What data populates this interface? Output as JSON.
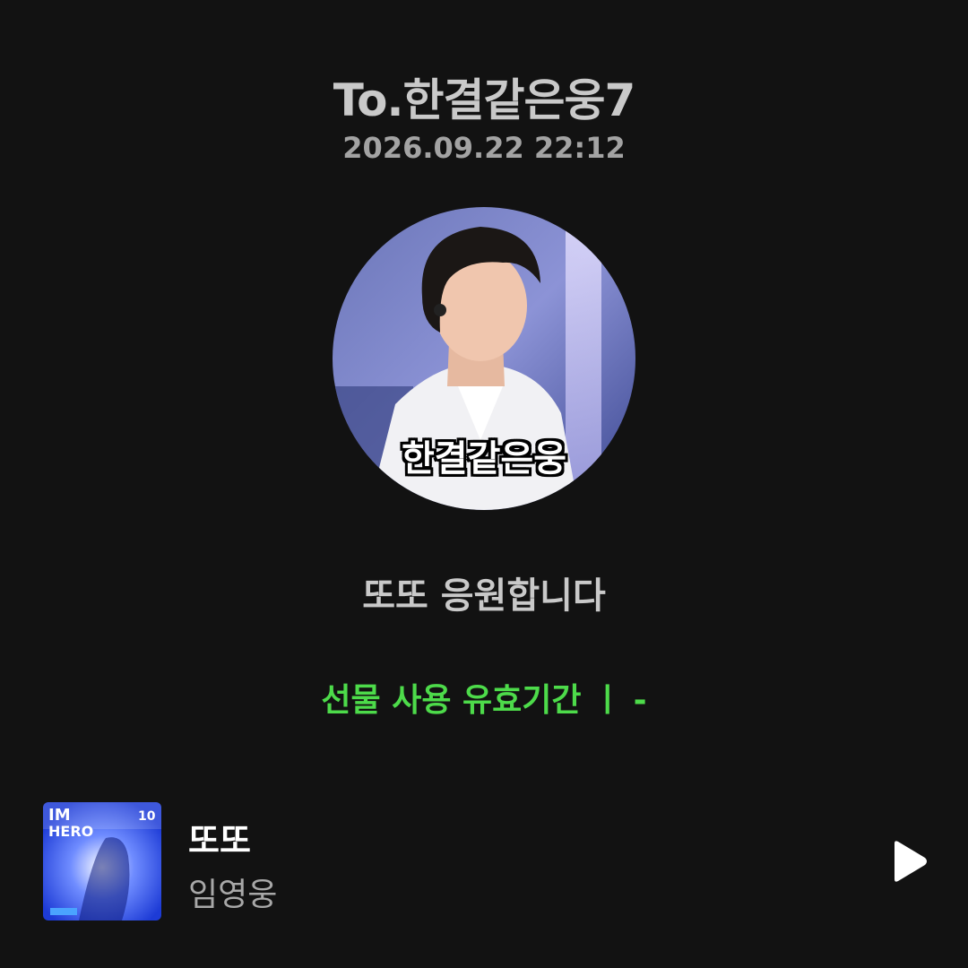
{
  "header": {
    "recipient": "To.한결같은웅7",
    "timestamp": "2026.09.22 22:12"
  },
  "avatar": {
    "caption": "한결같은웅"
  },
  "message": "또또 응원합니다",
  "gift": {
    "validity_text": "선물 사용 유효기간 ㅣ  -"
  },
  "track": {
    "title": "또또",
    "artist": "임영웅",
    "album_cover_text": "IM HERO",
    "play_icon": "play-icon"
  },
  "colors": {
    "background": "#121212",
    "accent_green": "#4ddb4a"
  }
}
